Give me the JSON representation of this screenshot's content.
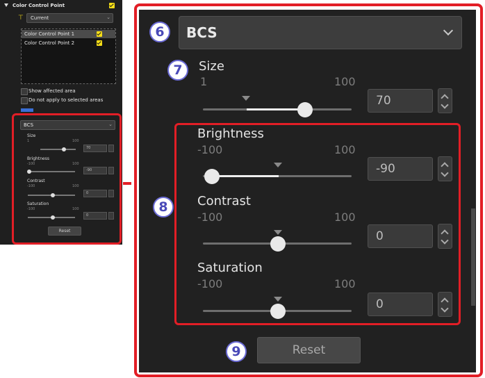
{
  "small_panel": {
    "section_title": "Color Control Point",
    "branch_select": "Current",
    "points": [
      {
        "label": "Color Control Point 1",
        "checked": true,
        "selected": true
      },
      {
        "label": "Color Control Point 2",
        "checked": true,
        "selected": false
      }
    ],
    "show_affected": "Show affected area",
    "do_not_apply": "Do not apply to selected areas",
    "mode": "BCS",
    "reset": "Reset",
    "sliders": [
      {
        "label": "Size",
        "min": "1",
        "max": "100",
        "value": "70",
        "level": 0.7
      },
      {
        "label": "Brightness",
        "min": "-100",
        "max": "100",
        "value": "-90",
        "level": 0.05
      },
      {
        "label": "Contrast",
        "min": "-100",
        "max": "100",
        "value": "0",
        "level": 0.5
      },
      {
        "label": "Saturation",
        "min": "-100",
        "max": "100",
        "value": "0",
        "level": 0.5
      }
    ]
  },
  "big_panel": {
    "mode": "BCS",
    "size": {
      "label": "Size",
      "min": "1",
      "max": "100",
      "value": "70",
      "level": 0.7
    },
    "brightness": {
      "label": "Brightness",
      "min": "-100",
      "max": "100",
      "value": "-90",
      "level": 0.05
    },
    "contrast": {
      "label": "Contrast",
      "min": "-100",
      "max": "100",
      "value": "0",
      "level": 0.5
    },
    "saturation": {
      "label": "Saturation",
      "min": "-100",
      "max": "100",
      "value": "0",
      "level": 0.5
    },
    "reset": "Reset"
  },
  "callouts": {
    "mode": "6",
    "size": "7",
    "bcs": "8",
    "reset": "9"
  },
  "colors": {
    "highlight": "#e21e26",
    "checkbox": "#f5dd18",
    "callout": "#4a4ab8"
  }
}
